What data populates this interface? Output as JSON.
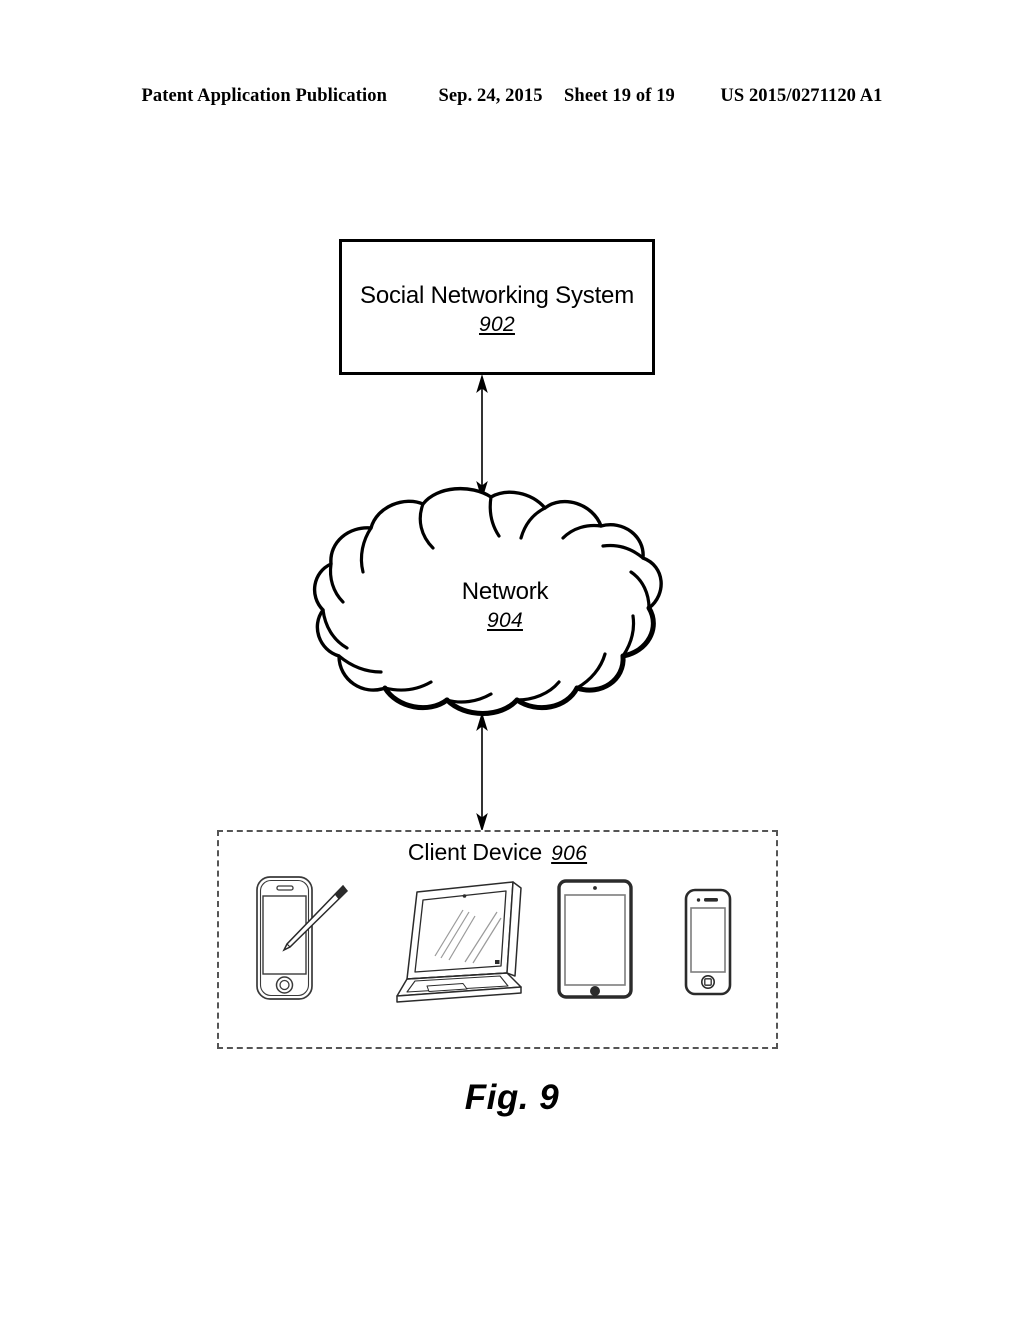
{
  "header": {
    "publication": "Patent Application Publication",
    "date": "Sep. 24, 2015",
    "sheet": "Sheet 19 of 19",
    "patent_number": "US 2015/0271120 A1"
  },
  "figure": {
    "caption": "Fig. 9",
    "nodes": {
      "social_networking_system": {
        "label": "Social Networking System",
        "ref": "902"
      },
      "network": {
        "label": "Network",
        "ref": "904"
      },
      "client_device": {
        "label": "Client Device",
        "ref": "906"
      }
    },
    "connections": [
      {
        "from": "902",
        "to": "904",
        "style": "double-arrow"
      },
      {
        "from": "904",
        "to": "906",
        "style": "double-arrow"
      }
    ],
    "devices": [
      {
        "name": "smartphone-with-stylus"
      },
      {
        "name": "laptop"
      },
      {
        "name": "tablet"
      },
      {
        "name": "smartphone"
      }
    ]
  },
  "colors": {
    "ink": "#000000",
    "paper": "#ffffff",
    "dashed": "#555555"
  }
}
